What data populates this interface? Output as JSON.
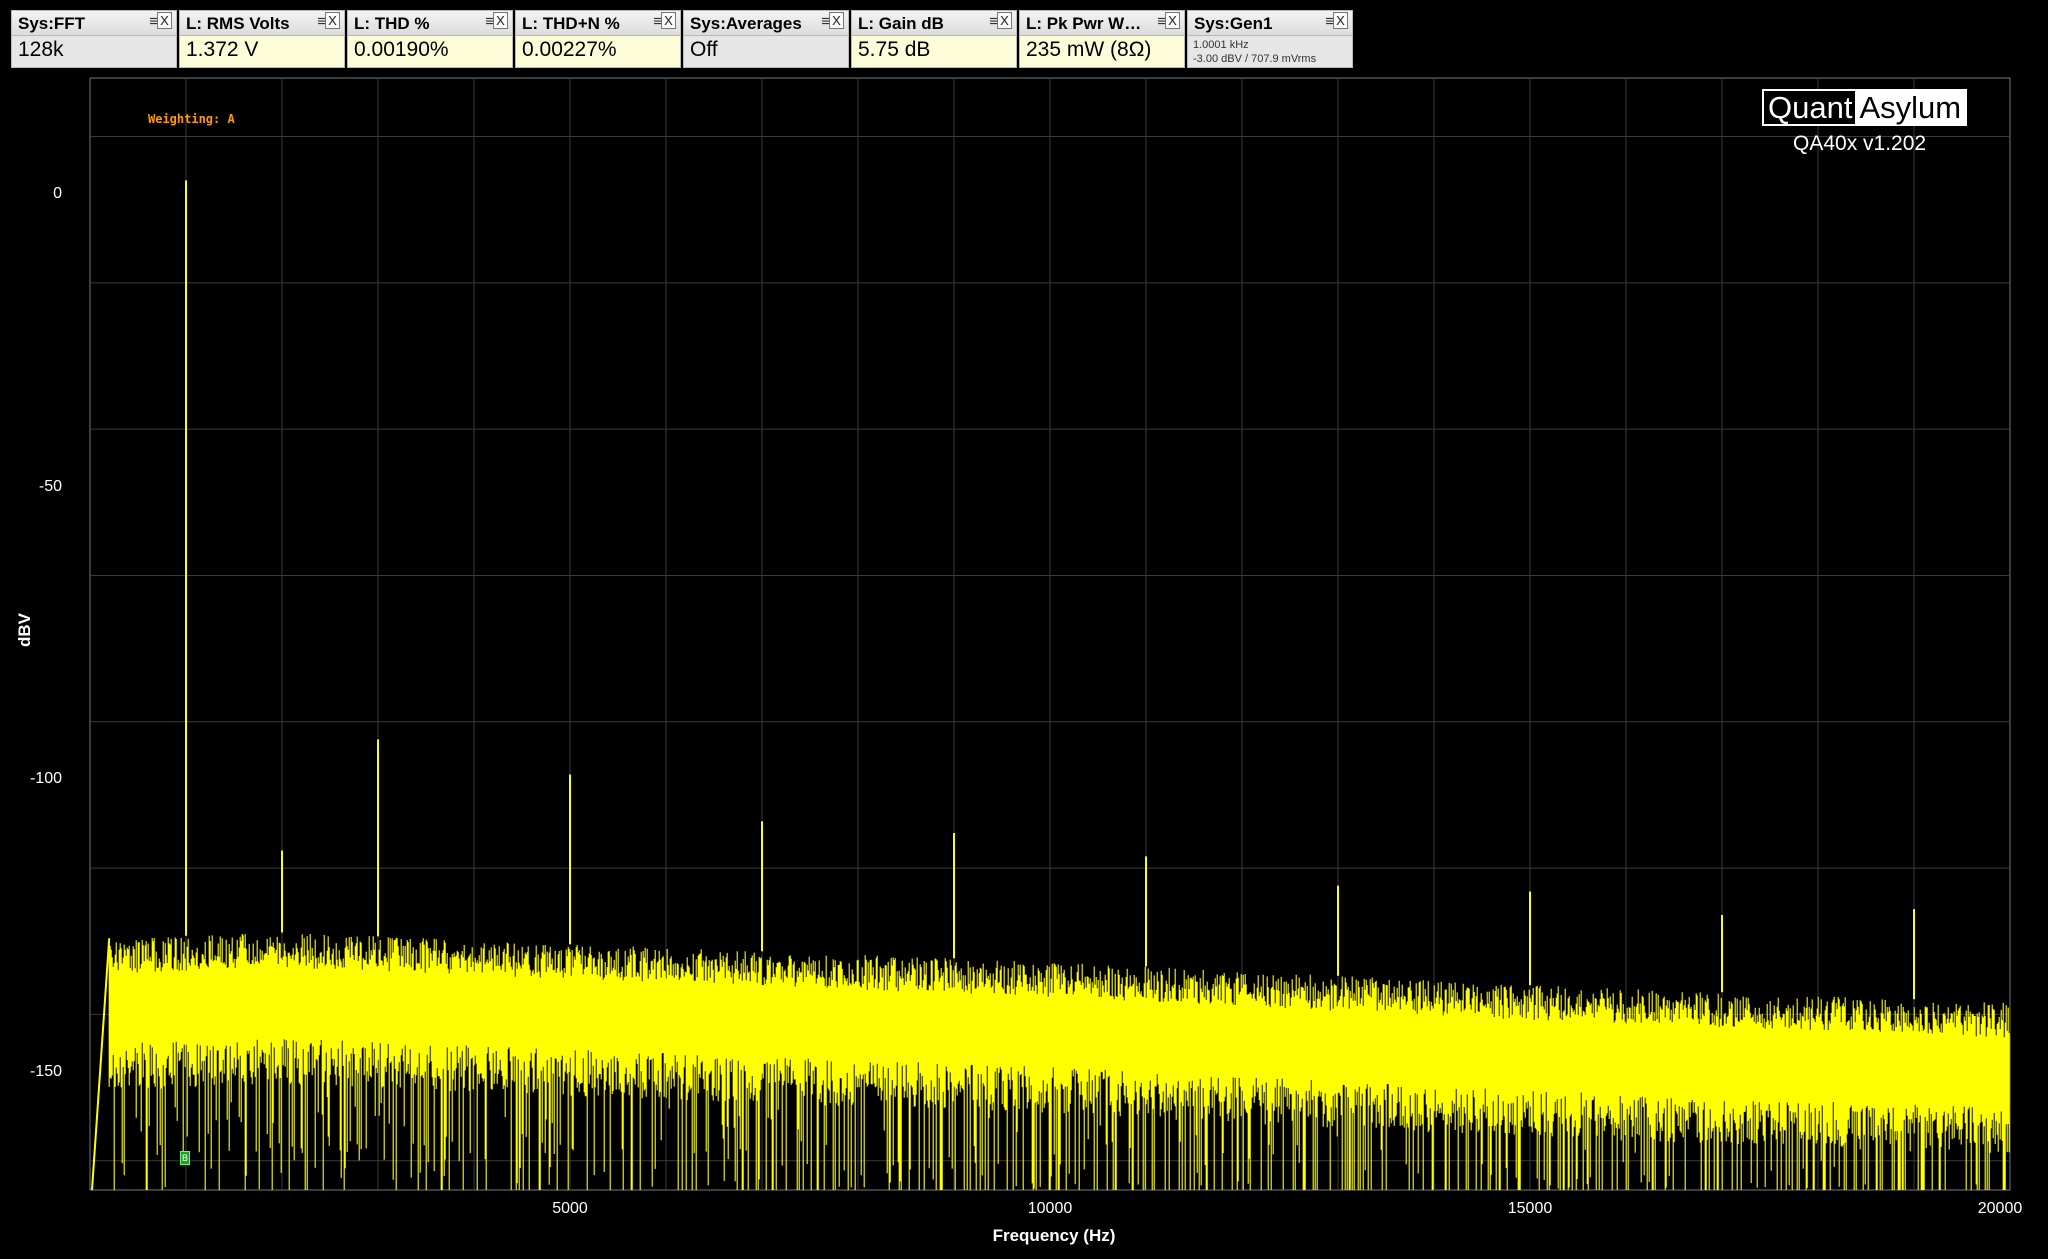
{
  "widgets": [
    {
      "title": "Sys:FFT",
      "value": "128k",
      "style": "grey"
    },
    {
      "title": "L: RMS Volts",
      "value": "1.372 V"
    },
    {
      "title": "L: THD %",
      "value": "0.00190%"
    },
    {
      "title": "L: THD+N %",
      "value": "0.00227%"
    },
    {
      "title": "Sys:Averages",
      "value": "Off",
      "style": "grey"
    },
    {
      "title": "L: Gain dB",
      "value": "5.75 dB"
    },
    {
      "title": "L: Pk Pwr W…",
      "value": "235 mW (8Ω)"
    },
    {
      "title": "Sys:Gen1",
      "line1": "1.0001 kHz",
      "line2": "-3.00 dBV  / 707.9 mVrms",
      "style": "grey"
    }
  ],
  "widget_menu_icon": "≡",
  "widget_close_icon": "X",
  "weighting": "Weighting: A",
  "logo": {
    "left": "Quant",
    "right": "Asylum"
  },
  "version": "QA40x v1.202",
  "marker_label": "B",
  "chart_data": {
    "type": "line",
    "xlabel": "Frequency (Hz)",
    "ylabel": "dBV",
    "xlim": [
      0,
      20000
    ],
    "ylim": [
      -170,
      20
    ],
    "xticks": [
      5000,
      10000,
      15000,
      20000
    ],
    "yticks": [
      0,
      -50,
      -100,
      -150
    ],
    "grid": true,
    "line_color": "#ffff00",
    "noise_floor": [
      [
        200,
        -127
      ],
      [
        2000,
        -126
      ],
      [
        5000,
        -128
      ],
      [
        10000,
        -131
      ],
      [
        15000,
        -135
      ],
      [
        20000,
        -138
      ]
    ],
    "peaks": [
      {
        "x": 1000,
        "y": 2.5
      },
      {
        "x": 2000,
        "y": -112
      },
      {
        "x": 3000,
        "y": -93
      },
      {
        "x": 5000,
        "y": -99
      },
      {
        "x": 7000,
        "y": -107
      },
      {
        "x": 9000,
        "y": -109
      },
      {
        "x": 11000,
        "y": -113
      },
      {
        "x": 13000,
        "y": -118
      },
      {
        "x": 15000,
        "y": -119
      },
      {
        "x": 17000,
        "y": -123
      },
      {
        "x": 19000,
        "y": -122
      }
    ]
  }
}
